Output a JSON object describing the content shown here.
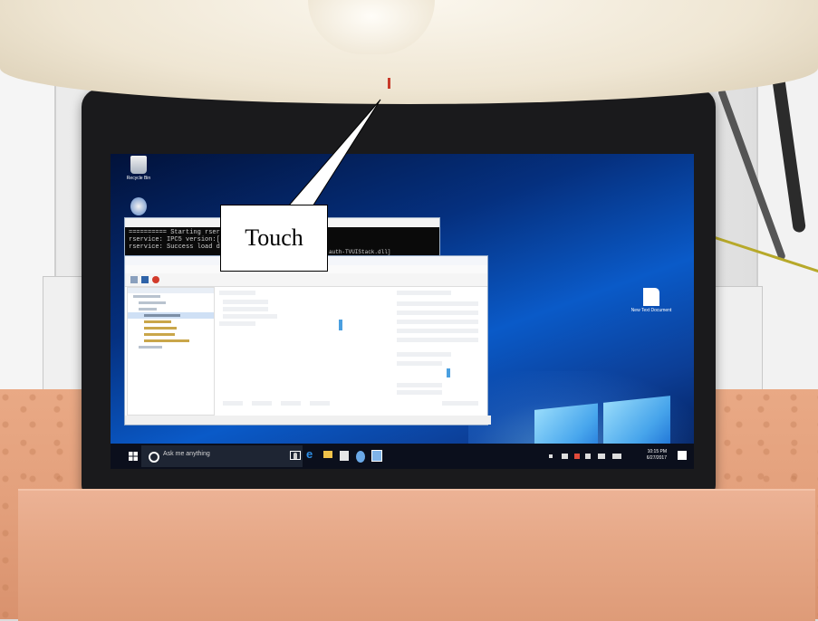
{
  "callout": {
    "label": "Touch"
  },
  "desktop": {
    "recycle_bin_label": "Recycle Bin",
    "text_document_label": "New Text Document"
  },
  "console": {
    "line_1": "========== Starting rservice",
    "line_2": "rservice: IPC5 version:[1.6.1",
    "line_3": "rservice: Success load dll",
    "line_right": "auth-TVUIStack.dll]"
  },
  "taskbar": {
    "search_placeholder": "Ask me anything",
    "time": "10:15 PM",
    "date": "6/27/2017"
  },
  "colors": {
    "wallpaper_blue": "#0a5ac8",
    "foam": "#e6a887",
    "bezel": "#1a1a1c",
    "taskbar": "#0b0f1c"
  }
}
